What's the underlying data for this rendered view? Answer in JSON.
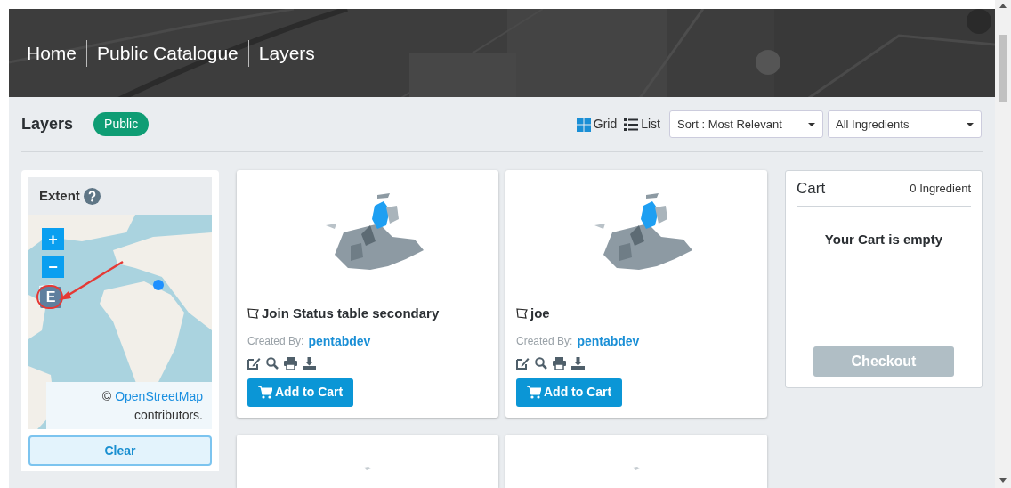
{
  "breadcrumb": [
    {
      "label": "Home"
    },
    {
      "label": "Public Catalogue"
    },
    {
      "label": "Layers"
    }
  ],
  "page_title": "Layers",
  "badge": "Public",
  "view_toggle": [
    {
      "label": "Grid",
      "kind": "grid",
      "selected": true
    },
    {
      "label": "List",
      "kind": "list",
      "selected": false
    }
  ],
  "sort_select": {
    "value": "Sort : Most Relevant"
  },
  "filter_select": {
    "value": "All Ingredients"
  },
  "extent": {
    "title": "Extent",
    "map_controls": [
      {
        "label": "+"
      },
      {
        "label": "−"
      },
      {
        "label": "E"
      }
    ],
    "attribution_prefix": "©",
    "attribution_link": "OpenStreetMap",
    "attribution_suffix": "contributors.",
    "clear_button": "Clear"
  },
  "cards": [
    {
      "title": "Join Status table secondary",
      "created_by_label": "Created By:",
      "author": "pentabdev",
      "button": "Add to Cart"
    },
    {
      "title": "joe",
      "created_by_label": "Created By:",
      "author": "pentabdev",
      "button": "Add to Cart"
    }
  ],
  "cart": {
    "title": "Cart",
    "count": "0 Ingredient",
    "empty_message": "Your Cart is empty",
    "checkout": {
      "label": "Checkout",
      "disabled": true
    }
  }
}
